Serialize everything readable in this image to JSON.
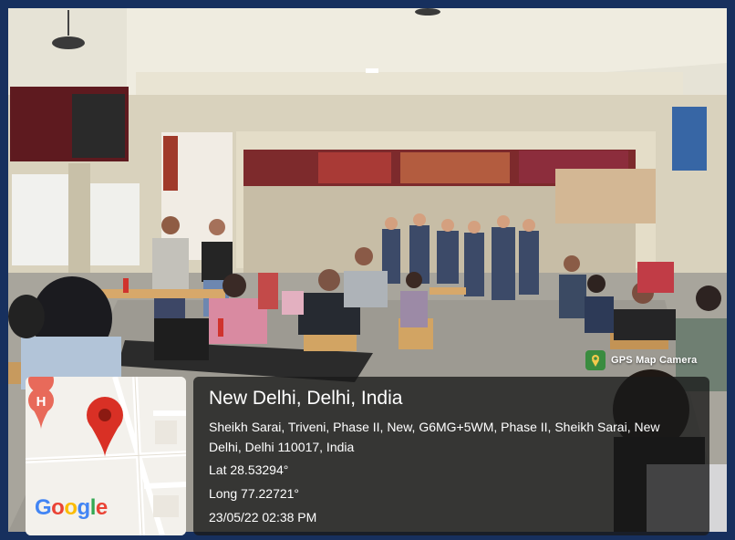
{
  "badge": {
    "label": "GPS Map Camera",
    "icon": "gps-map-camera-icon"
  },
  "location": {
    "title": "New Delhi, Delhi, India",
    "address": "Sheikh Sarai, Triveni, Phase II, New, G6MG+5WM, Phase II, Sheikh Sarai, New Delhi, Delhi 110017, India",
    "lat": "Lat 28.53294°",
    "long": "Long 77.22721°",
    "datetime": "23/05/22 02:38 PM"
  },
  "map": {
    "logo_letters": [
      "G",
      "o",
      "o",
      "g",
      "l",
      "e"
    ],
    "logo_colors": [
      "#4285F4",
      "#EA4335",
      "#FBBC05",
      "#4285F4",
      "#34A853",
      "#EA4335"
    ],
    "hotel_marker": "H",
    "pin_color": "#d93025"
  },
  "colors": {
    "border": "#17305e",
    "card_bg": "#191919"
  }
}
